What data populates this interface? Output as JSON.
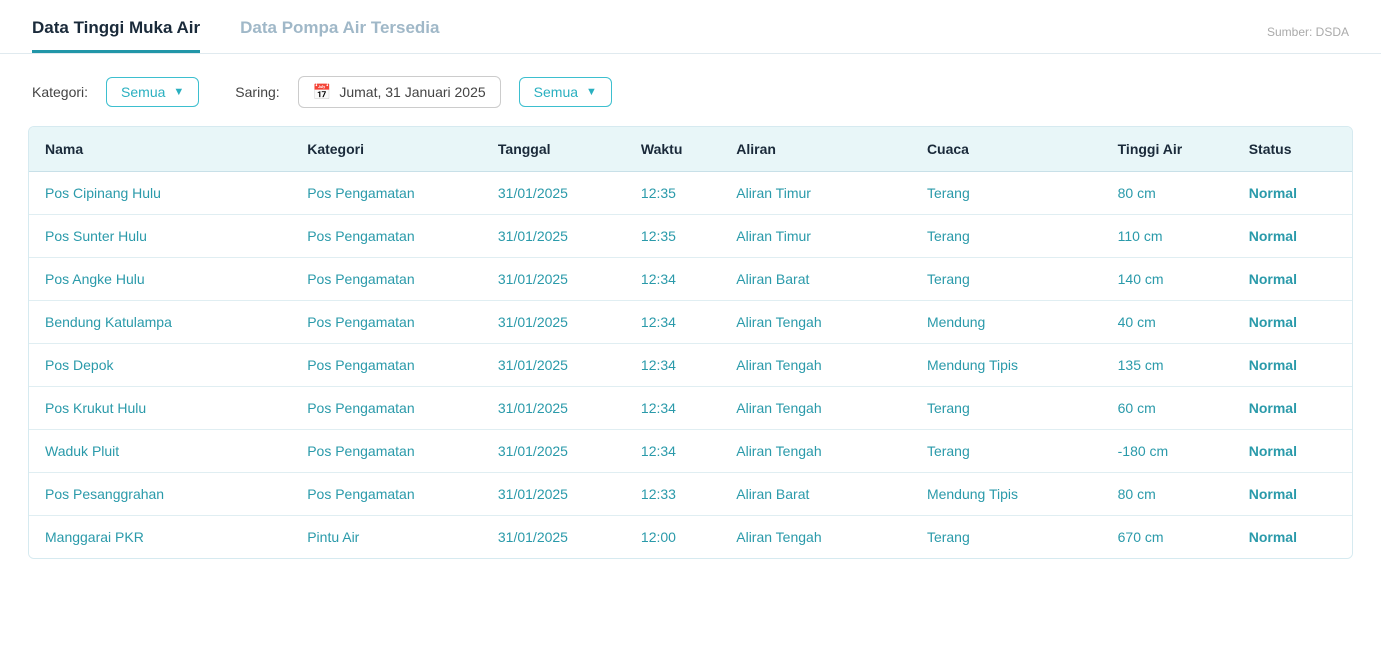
{
  "tabs": [
    {
      "id": "tinggi-muka-air",
      "label": "Data Tinggi Muka Air",
      "active": true
    },
    {
      "id": "pompa-air",
      "label": "Data Pompa Air Tersedia",
      "active": false
    }
  ],
  "source": "Sumber: DSDA",
  "filter": {
    "kategori_label": "Kategori:",
    "kategori_value": "Semua",
    "saring_label": "Saring:",
    "date_value": "Jumat, 31 Januari 2025",
    "status_value": "Semua"
  },
  "table": {
    "headers": [
      "Nama",
      "Kategori",
      "Tanggal",
      "Waktu",
      "Aliran",
      "Cuaca",
      "Tinggi Air",
      "Status"
    ],
    "rows": [
      {
        "nama": "Pos Cipinang Hulu",
        "kategori": "Pos Pengamatan",
        "tanggal": "31/01/2025",
        "waktu": "12:35",
        "aliran": "Aliran Timur",
        "cuaca": "Terang",
        "tinggi": "80 cm",
        "status": "Normal"
      },
      {
        "nama": "Pos Sunter Hulu",
        "kategori": "Pos Pengamatan",
        "tanggal": "31/01/2025",
        "waktu": "12:35",
        "aliran": "Aliran Timur",
        "cuaca": "Terang",
        "tinggi": "110 cm",
        "status": "Normal"
      },
      {
        "nama": "Pos Angke Hulu",
        "kategori": "Pos Pengamatan",
        "tanggal": "31/01/2025",
        "waktu": "12:34",
        "aliran": "Aliran Barat",
        "cuaca": "Terang",
        "tinggi": "140 cm",
        "status": "Normal"
      },
      {
        "nama": "Bendung Katulampa",
        "kategori": "Pos Pengamatan",
        "tanggal": "31/01/2025",
        "waktu": "12:34",
        "aliran": "Aliran Tengah",
        "cuaca": "Mendung",
        "tinggi": "40 cm",
        "status": "Normal"
      },
      {
        "nama": "Pos Depok",
        "kategori": "Pos Pengamatan",
        "tanggal": "31/01/2025",
        "waktu": "12:34",
        "aliran": "Aliran Tengah",
        "cuaca": "Mendung Tipis",
        "tinggi": "135 cm",
        "status": "Normal"
      },
      {
        "nama": "Pos Krukut Hulu",
        "kategori": "Pos Pengamatan",
        "tanggal": "31/01/2025",
        "waktu": "12:34",
        "aliran": "Aliran Tengah",
        "cuaca": "Terang",
        "tinggi": "60 cm",
        "status": "Normal"
      },
      {
        "nama": "Waduk Pluit",
        "kategori": "Pos Pengamatan",
        "tanggal": "31/01/2025",
        "waktu": "12:34",
        "aliran": "Aliran Tengah",
        "cuaca": "Terang",
        "tinggi": "-180 cm",
        "status": "Normal"
      },
      {
        "nama": "Pos Pesanggrahan",
        "kategori": "Pos Pengamatan",
        "tanggal": "31/01/2025",
        "waktu": "12:33",
        "aliran": "Aliran Barat",
        "cuaca": "Mendung Tipis",
        "tinggi": "80 cm",
        "status": "Normal"
      },
      {
        "nama": "Manggarai PKR",
        "kategori": "Pintu Air",
        "tanggal": "31/01/2025",
        "waktu": "12:00",
        "aliran": "Aliran Tengah",
        "cuaca": "Terang",
        "tinggi": "670 cm",
        "status": "Normal"
      }
    ]
  }
}
